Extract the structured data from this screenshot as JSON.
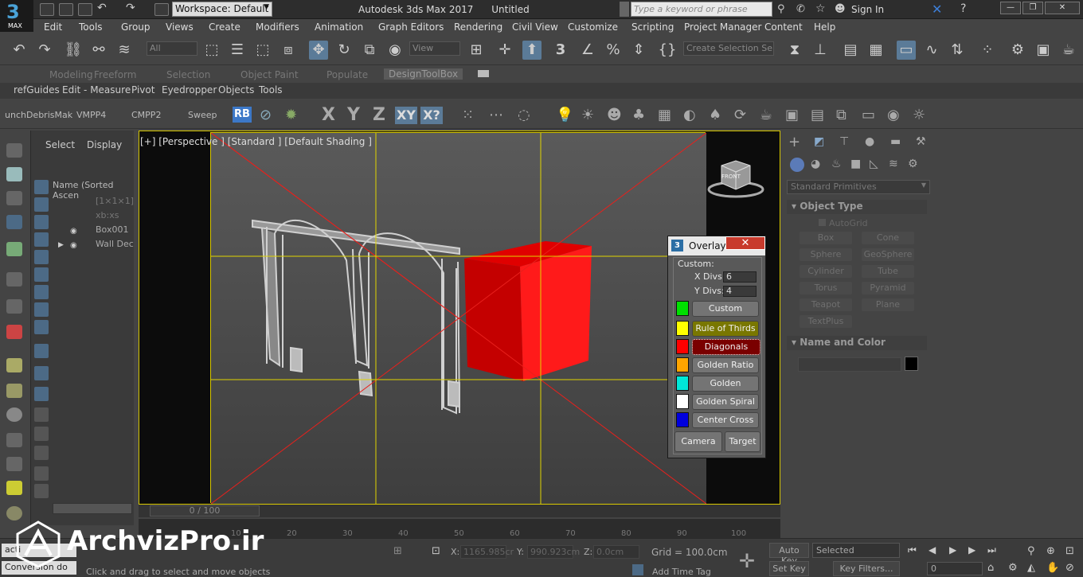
{
  "app": {
    "logo_number": "3",
    "logo_sub": "MAX",
    "title": "Autodesk 3ds Max 2017",
    "document": "Untitled"
  },
  "workspace": {
    "value": "Workspace: Default"
  },
  "search": {
    "placeholder": "Type a keyword or phrase"
  },
  "account": {
    "signin": "Sign In"
  },
  "menu": [
    "Edit",
    "Tools",
    "Group",
    "Views",
    "Create",
    "Modifiers",
    "Animation",
    "Graph Editors",
    "Rendering",
    "Civil View",
    "Customize",
    "Scripting",
    "Project Manager",
    "Content",
    "Help"
  ],
  "toolbar": {
    "filter": "All",
    "view_dropdown": "View",
    "selection_set": "Create Selection Se",
    "snap_label": "3"
  },
  "ribbon": {
    "tabs": [
      "Modeling",
      "Freeform",
      "Selection",
      "Object Paint",
      "Populate",
      "DesignToolBox"
    ],
    "selected": "DesignToolBox",
    "sub_items": [
      "refGuides",
      "Edit - Measure",
      "Pivot",
      "Eyedropper",
      "Objects",
      "Tools"
    ]
  },
  "toolbar3": {
    "items": [
      "unchDebrisMak",
      "VMPP4",
      "CMPP2",
      "Sweep"
    ],
    "rb": "RB",
    "axes": [
      "X",
      "Y",
      "Z"
    ],
    "xy": "XY",
    "xq": "X?"
  },
  "explorer": {
    "tabs": [
      "Select",
      "Display"
    ],
    "column_header": "Name (Sorted Ascen",
    "rows": [
      "[1×1×1]",
      "xb:xs",
      "Box001",
      "Wall Deco"
    ]
  },
  "viewport": {
    "label": "[+] [Perspective ] [Standard ] [Default Shading ]",
    "time": "0 / 100"
  },
  "ruler": {
    "ticks": [
      "10",
      "20",
      "30",
      "40",
      "50",
      "60",
      "70",
      "80",
      "90",
      "100"
    ]
  },
  "status": {
    "x_label": "X:",
    "x_value": "1165.985cr",
    "y_label": "Y:",
    "y_value": "990.923cm",
    "z_label": "Z:",
    "z_value": "0.0cm",
    "grid": "Grid = 100.0cm",
    "prompt": "Click and drag to select and move objects",
    "add_time_tag": "Add Time Tag",
    "auto_key": "Auto Key",
    "selected": "Selected",
    "set_key": "Set Key",
    "key_filters": "Key Filters...",
    "frame": "0",
    "script_a": "acti",
    "script_b": "Conversion do"
  },
  "command_panel": {
    "category": "Standard Primitives",
    "object_type_title": "Object Type",
    "autogrid": "AutoGrid",
    "buttons": [
      "Box",
      "Cone",
      "Sphere",
      "GeoSphere",
      "Cylinder",
      "Tube",
      "Torus",
      "Pyramid",
      "Teapot",
      "Plane",
      "TextPlus"
    ],
    "name_color_title": "Name and Color"
  },
  "overlay": {
    "title": "Overlay",
    "close": "✕",
    "custom_label": "Custom:",
    "xdivs_label": "X Divs:",
    "xdivs_value": "6",
    "ydivs_label": "Y Divs:",
    "ydivs_value": "4",
    "buttons": [
      "Custom",
      "Rule of Thirds",
      "Diagonals",
      "Golden Ratio",
      "Golden Triangle",
      "Golden Spiral",
      "Center Cross"
    ],
    "colors": [
      "#00e000",
      "#ffff00",
      "#ff0000",
      "#ffa500",
      "#00e8d8",
      "#ffffff",
      "#0000dd"
    ],
    "camera": "Camera",
    "target": "Target"
  },
  "watermark": {
    "text": "ArchvizPro.ir"
  },
  "viewcube_label": "FRONT"
}
